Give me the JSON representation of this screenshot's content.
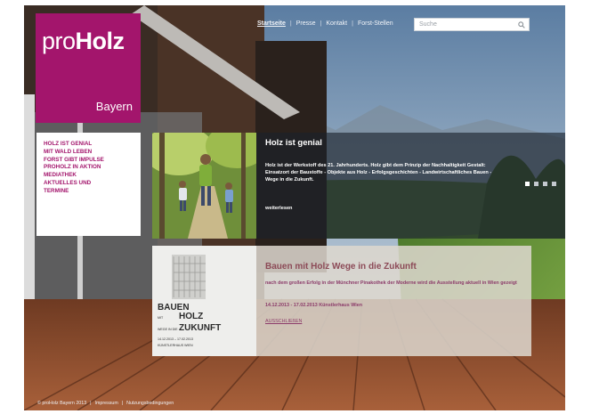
{
  "colors": {
    "brand": "#a3156c",
    "nav_text": "#a3156c",
    "panel_dark": "#1a222c",
    "panel_light": "#ddd7ce"
  },
  "logo": {
    "wordmark_light": "pro",
    "wordmark_bold": "Holz",
    "region": "Bayern"
  },
  "topnav": {
    "items": [
      "Startseite",
      "Presse",
      "Kontakt",
      "Forst-Stellen"
    ]
  },
  "search": {
    "placeholder": "Suche",
    "icon": "search-icon"
  },
  "sidenav": {
    "items": [
      "HOLZ IST GENIAL",
      "MIT WALD LEBEN",
      "FORST GIBT IMPULSE",
      "PROHOLZ IN AKTION",
      "MEDIATHEK",
      "AKTUELLES UND",
      "TERMINE"
    ]
  },
  "hero": {
    "title": "Holz ist genial",
    "text": "Holz ist der Werkstoff des 21. Jahrhunderts. Holz gibt dem Prinzip der Nachhaltigkeit Gestalt: Einsatzort der Baustoffe - Objekte aus Holz - Erfolgsgeschichten - Landwirtschaftliches Bauen - Wege in die Zukunft.",
    "more": "weiterlesen",
    "slides_total": 4,
    "slide_active": 1
  },
  "poster": {
    "line1": "BAUEN",
    "line2_small": "MIT",
    "line2_big": "HOLZ",
    "line3_small": "WEGE IN DIE",
    "line3_big": "ZUKUNFT",
    "date_line": "14.12.2013 – 17.02.2013",
    "venue_line": "KÜNSTLERHAUS WIEN"
  },
  "info": {
    "title": "Bauen mit Holz Wege in die Zukunft",
    "text": "nach dem großen Erfolg in der Münchner Pinakothek der Moderne wird die Ausstellung aktuell in Wien gezeigt",
    "date": "14.12.2013 - 17.02.2013 Künstlerhaus Wien",
    "more": "AUSSCHLIEßEN"
  },
  "footer": {
    "items": [
      "© proHolz Bayern 2013",
      "Impressum",
      "Nutzungsbedingungen"
    ]
  }
}
